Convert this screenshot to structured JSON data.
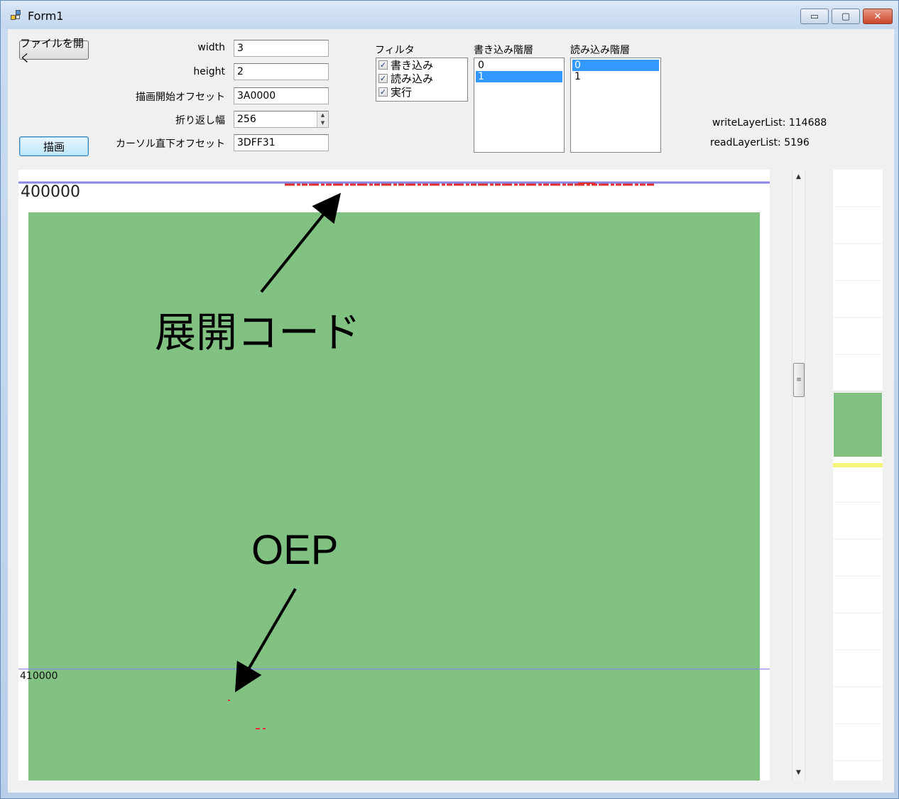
{
  "window": {
    "title": "Form1",
    "minimize_glyph": "▭",
    "maximize_glyph": "▢",
    "close_glyph": "✕"
  },
  "controls": {
    "open_file_button": "ファイルを開く",
    "draw_button": "描画",
    "width_label": "width",
    "width_value": "3",
    "height_label": "height",
    "height_value": "2",
    "start_offset_label": "描画開始オフセット",
    "start_offset_value": "3A0000",
    "wrap_label": "折り返し幅",
    "wrap_value": "256",
    "cursor_offset_label": "カーソル直下オフセット",
    "cursor_offset_value": "3DFF31"
  },
  "filter": {
    "title": "フィルタ",
    "items": [
      {
        "label": "書き込み",
        "checked": true
      },
      {
        "label": "読み込み",
        "checked": true
      },
      {
        "label": "実行",
        "checked": true
      }
    ]
  },
  "write_layers": {
    "title": "書き込み階層",
    "items": [
      "0",
      "1"
    ],
    "selected": "1"
  },
  "read_layers": {
    "title": "読み込み階層",
    "items": [
      "0",
      "1"
    ],
    "selected": "0"
  },
  "stats": {
    "write_layer_list": "writeLayerList: 114688",
    "read_layer_list": "readLayerList: 5196"
  },
  "canvas": {
    "address_top": "400000",
    "address_mid": "410000",
    "annotation_unpack": "展開コード",
    "annotation_oep": "OEP",
    "colors": {
      "fill": "#81c282",
      "line": "#8a86e8",
      "write_mark": "#e03030",
      "read_mark": "#f5f57a"
    }
  }
}
